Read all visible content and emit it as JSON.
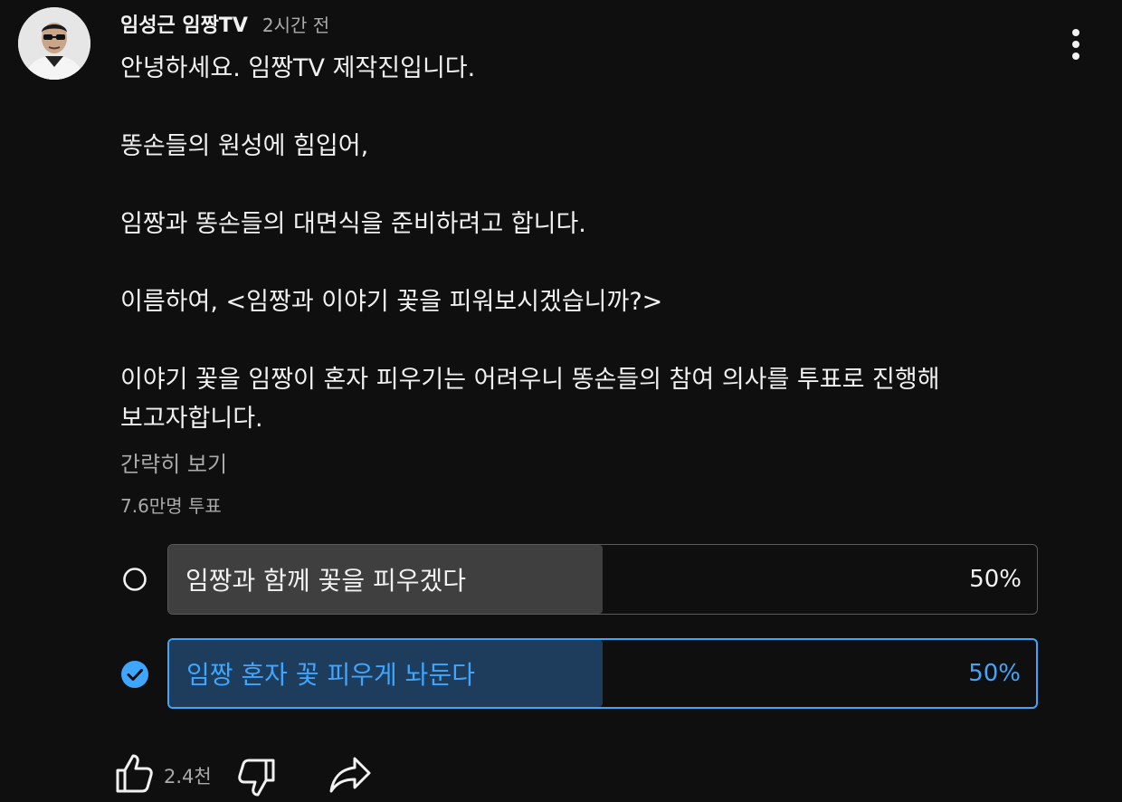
{
  "post": {
    "author": "임성근 임짱TV",
    "time": "2시간 전",
    "lines": [
      "안녕하세요. 임짱TV 제작진입니다.",
      "",
      "똥손들의 원성에 힘입어,",
      "",
      "임짱과 똥손들의 대면식을 준비하려고 합니다.",
      "",
      "이름하여, <임짱과 이야기 꽃을 피워보시겠습니까?>",
      "",
      "이야기 꽃을 임짱이 혼자 피우기는 어려우니 똥손들의 참여 의사를 투표로 진행해",
      "보고자합니다."
    ],
    "show_less": "간략히 보기"
  },
  "poll": {
    "vote_count": "7.6만명 투표",
    "options": [
      {
        "label": "임짱과 함께 꽃을 피우겠다",
        "percent": "50%",
        "fill": 0.5,
        "selected": false
      },
      {
        "label": "임짱 혼자 꽃 피우게 놔둔다",
        "percent": "50%",
        "fill": 0.5,
        "selected": true
      }
    ]
  },
  "actions": {
    "like_count": "2.4천",
    "icons": [
      "menu-dots-icon",
      "radio-empty-icon",
      "check-circle-icon",
      "thumbs-up-icon",
      "thumbs-down-icon",
      "share-icon"
    ]
  },
  "colors": {
    "background": "#0f0f0f",
    "text": "#f1f1f1",
    "secondary_text": "#aaaaaa",
    "accent": "#3ea6ff",
    "selected_fill": "#1e3c5c",
    "unselected_fill": "#3f3f3f"
  }
}
